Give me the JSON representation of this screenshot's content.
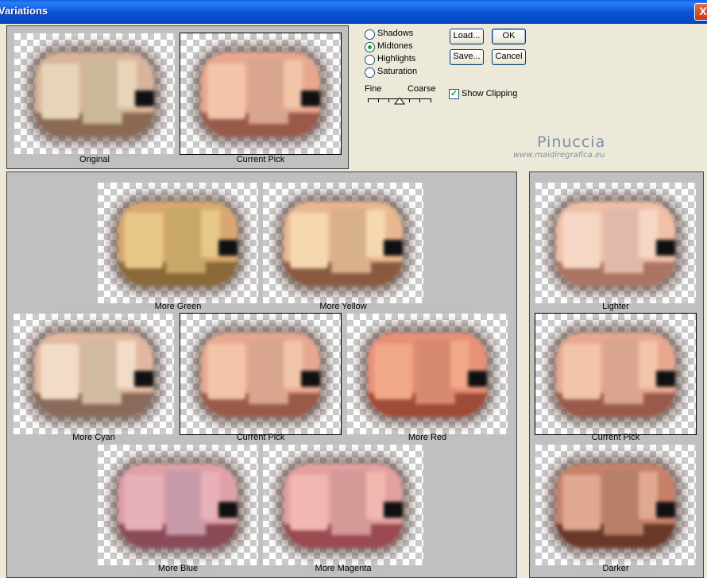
{
  "window": {
    "title": "Variations",
    "close_glyph": "X"
  },
  "top_panel": {
    "original_caption": "Original",
    "current_caption": "Current Pick"
  },
  "tone_options": [
    {
      "label": "Shadows",
      "selected": false
    },
    {
      "label": "Midtones",
      "selected": true
    },
    {
      "label": "Highlights",
      "selected": false
    },
    {
      "label": "Saturation",
      "selected": false
    }
  ],
  "buttons": {
    "load": "Load...",
    "save": "Save...",
    "ok": "OK",
    "cancel": "Cancel"
  },
  "slider": {
    "fine_label": "Fine",
    "coarse_label": "Coarse",
    "value_position": 0.5
  },
  "show_clipping": {
    "label": "Show Clipping",
    "checked": true
  },
  "watermark": {
    "name": "Pinuccia",
    "url": "www.maidiregrafica.eu"
  },
  "variations": {
    "more_green": "More Green",
    "more_yellow": "More Yellow",
    "more_cyan": "More Cyan",
    "current_pick": "Current Pick",
    "more_red": "More Red",
    "more_blue": "More Blue",
    "more_magenta": "More Magenta"
  },
  "brightness": {
    "lighter": "Lighter",
    "current_pick": "Current Pick",
    "darker": "Darker"
  },
  "tints": {
    "original": {
      "wall": "#e8d4b8",
      "panel": "#cbb89a",
      "floor": "#8a6a52",
      "side": "#d8b49a"
    },
    "current": {
      "wall": "#f2c4a8",
      "panel": "#d9a58e",
      "floor": "#9a5a4a",
      "side": "#e8a890"
    },
    "green": {
      "wall": "#e8c888",
      "panel": "#c8a868",
      "floor": "#8a6838",
      "side": "#d8a870"
    },
    "yellow": {
      "wall": "#f5d8b0",
      "panel": "#d8b08a",
      "floor": "#8a5a40",
      "side": "#e8b890"
    },
    "cyan": {
      "wall": "#f2dcc8",
      "panel": "#d2baa2",
      "floor": "#8a6a5a",
      "side": "#e2b8a0"
    },
    "red": {
      "wall": "#f0a888",
      "panel": "#d88a70",
      "floor": "#a04a38",
      "side": "#e89078"
    },
    "blue": {
      "wall": "#e8b0b8",
      "panel": "#c89aa8",
      "floor": "#8a4a58",
      "side": "#e0a0a8"
    },
    "magenta": {
      "wall": "#f0b8b0",
      "panel": "#d49a98",
      "floor": "#9a4a50",
      "side": "#e4a0a0"
    },
    "lighter": {
      "wall": "#f6d6c4",
      "panel": "#e2b8a8",
      "floor": "#ac7464",
      "side": "#f0c0a8"
    },
    "darker": {
      "wall": "#e0a890",
      "panel": "#b88068",
      "floor": "#6a3828",
      "side": "#c88068"
    }
  }
}
